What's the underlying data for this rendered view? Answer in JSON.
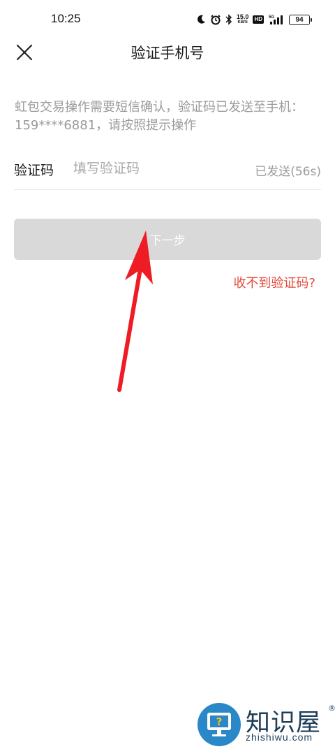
{
  "status_bar": {
    "time": "10:25",
    "net_speed_value": "15.0",
    "net_speed_unit": "KB/S",
    "hd_label": "HD",
    "signal_label": "5G",
    "battery": "94"
  },
  "nav": {
    "title": "验证手机号",
    "close_icon": "close-icon"
  },
  "description": "虹包交易操作需要短信确认，验证码已发送至手机：159****6881，请按照提示操作",
  "code_field": {
    "label": "验证码",
    "placeholder": "填写验证码",
    "value": "",
    "resend_status": "已发送(56s)"
  },
  "next_button": {
    "label": "下一步"
  },
  "help_link": {
    "label": "收不到验证码?"
  },
  "annotation": {
    "color": "#ee1c24",
    "icon": "red-arrow"
  },
  "watermark": {
    "name": "知识屋",
    "registered": "®",
    "site": "zhishiwu.com",
    "logo_color": "#2a88c8"
  },
  "colors": {
    "accent_red": "#e24a3b",
    "disabled_button": "#d9d9d9",
    "muted_text": "#9a9a9a"
  }
}
